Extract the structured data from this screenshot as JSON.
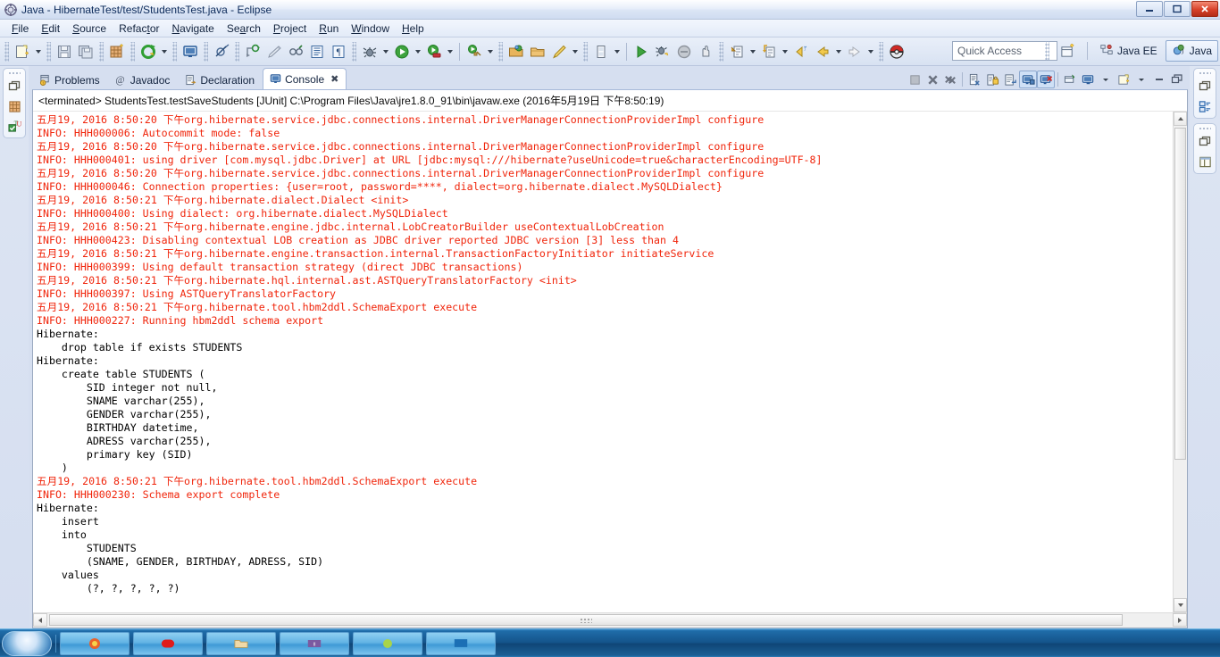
{
  "window": {
    "title": "Java - HibernateTest/test/StudentsTest.java - Eclipse",
    "icon": "eclipse-icon",
    "minimize_label": "–",
    "maximize_label": "❐",
    "close_label": "✕"
  },
  "menubar": {
    "items": [
      {
        "label": "File",
        "mnemonic": "F"
      },
      {
        "label": "Edit",
        "mnemonic": "E"
      },
      {
        "label": "Source",
        "mnemonic": "S"
      },
      {
        "label": "Refactor",
        "mnemonic": "t"
      },
      {
        "label": "Navigate",
        "mnemonic": "N"
      },
      {
        "label": "Search",
        "mnemonic": "a"
      },
      {
        "label": "Project",
        "mnemonic": "P"
      },
      {
        "label": "Run",
        "mnemonic": "R"
      },
      {
        "label": "Window",
        "mnemonic": "W"
      },
      {
        "label": "Help",
        "mnemonic": "H"
      }
    ]
  },
  "toolbar": {
    "quick_access_placeholder": "Quick Access",
    "buttons": [
      {
        "name": "new-wizard-button",
        "icon": "new-file-icon"
      },
      {
        "name": "save-button",
        "icon": "save-icon"
      },
      {
        "name": "save-all-button",
        "icon": "save-all-icon"
      },
      {
        "name": "new-java-package-button",
        "icon": "package-icon"
      },
      {
        "name": "run-last-tool-button",
        "icon": "refresh-green-icon"
      },
      {
        "name": "open-console-button",
        "icon": "console-icon"
      },
      {
        "name": "skip-breakpoints-button",
        "icon": "no-breakpoint-icon"
      },
      {
        "name": "toggle-mark-occurrences-button",
        "icon": "mark-occurrences-icon"
      },
      {
        "name": "new-java-class-button",
        "icon": "pen-icon"
      },
      {
        "name": "search-button",
        "icon": "search-glasses-icon"
      },
      {
        "name": "open-task-button",
        "icon": "task-list-icon"
      },
      {
        "name": "open-type-button",
        "icon": "type-icon"
      },
      {
        "name": "debug-button",
        "icon": "debug-bug-icon"
      },
      {
        "name": "run-button",
        "icon": "run-green-play-icon"
      },
      {
        "name": "run-server-button",
        "icon": "run-server-icon"
      },
      {
        "name": "external-tools-button",
        "icon": "external-tools-icon"
      },
      {
        "name": "open-perspective-button",
        "icon": "open-folder-green-icon"
      },
      {
        "name": "open-resource-button",
        "icon": "open-folder-icon"
      },
      {
        "name": "annotation-button",
        "icon": "pencil-yellow-icon"
      },
      {
        "name": "coverage-button",
        "icon": "coverage-icon"
      },
      {
        "name": "resume-button",
        "icon": "resume-green-icon"
      },
      {
        "name": "debug-last-button",
        "icon": "debug-last-icon"
      },
      {
        "name": "terminate-button",
        "icon": "terminate-gray-icon"
      },
      {
        "name": "suspend-button",
        "icon": "hand-icon"
      },
      {
        "name": "step-into-button",
        "icon": "step-into-icon"
      },
      {
        "name": "step-return-button",
        "icon": "step-return-icon"
      },
      {
        "name": "previous-annotation-button",
        "icon": "back-yellow-arrow-icon"
      },
      {
        "name": "back-button",
        "icon": "back-arrow-icon"
      },
      {
        "name": "forward-button",
        "icon": "forward-arrow-icon"
      },
      {
        "name": "pokeball-button",
        "icon": "pokeball-icon"
      }
    ],
    "perspectives": [
      {
        "name": "open-perspective",
        "label": "",
        "icon": "open-perspective-icon",
        "selected": false
      },
      {
        "name": "perspective-java-ee",
        "label": "Java EE",
        "icon": "java-ee-icon",
        "selected": false
      },
      {
        "name": "perspective-java",
        "label": "Java",
        "icon": "java-icon",
        "selected": true
      }
    ]
  },
  "left_rail": {
    "groups": [
      {
        "items": [
          {
            "name": "restore-icon",
            "icon": "restore-icon"
          },
          {
            "name": "package-explorer-icon",
            "icon": "package-explorer-icon"
          },
          {
            "name": "junit-icon",
            "icon": "junit-icon"
          }
        ]
      }
    ]
  },
  "right_rail": {
    "groups": [
      {
        "items": [
          {
            "name": "restore-icon",
            "icon": "restore-icon"
          },
          {
            "name": "outline-icon",
            "icon": "outline-icon"
          }
        ]
      },
      {
        "items": [
          {
            "name": "restore-icon",
            "icon": "restore-icon"
          },
          {
            "name": "task-list-icon",
            "icon": "task-list-icon"
          }
        ]
      }
    ]
  },
  "view_tabs": [
    {
      "label": "Problems",
      "icon": "problems-icon",
      "active": false,
      "closable": false
    },
    {
      "label": "Javadoc",
      "icon": "javadoc-at-icon",
      "active": false,
      "closable": false
    },
    {
      "label": "Declaration",
      "icon": "declaration-icon",
      "active": false,
      "closable": false
    },
    {
      "label": "Console",
      "icon": "console-icon",
      "active": true,
      "closable": true,
      "close_glyph": "✖"
    }
  ],
  "view_toolbar": {
    "buttons": [
      {
        "name": "terminate-button",
        "icon": "terminate-square-icon",
        "on": false
      },
      {
        "name": "remove-launch-button",
        "icon": "remove-x-icon",
        "on": false
      },
      {
        "name": "remove-all-terminated-button",
        "icon": "remove-all-x-icon",
        "on": false
      },
      {
        "name": "clear-console-button",
        "icon": "clear-console-icon",
        "on": false
      },
      {
        "name": "scroll-lock-button",
        "icon": "scroll-lock-icon",
        "on": false
      },
      {
        "name": "word-wrap-button",
        "icon": "word-wrap-icon",
        "on": false
      },
      {
        "name": "show-console-on-output-button",
        "icon": "show-console-stdout-icon",
        "on": true
      },
      {
        "name": "show-console-on-error-button",
        "icon": "show-console-stderr-icon",
        "on": true
      },
      {
        "name": "pin-console-button",
        "icon": "pin-console-icon",
        "on": false
      },
      {
        "name": "display-selected-console-button",
        "icon": "display-console-icon",
        "on": false
      },
      {
        "name": "open-console-button",
        "icon": "new-console-icon",
        "on": false
      },
      {
        "name": "minimize-button",
        "icon": "minimize-icon",
        "on": false
      },
      {
        "name": "maximize-button",
        "icon": "maximize-icon",
        "on": false
      }
    ]
  },
  "console": {
    "header": "<terminated> StudentsTest.testSaveStudents [JUnit] C:\\Program Files\\Java\\jre1.8.0_91\\bin\\javaw.exe (2016年5月19日 下午8:50:19)",
    "lines": [
      {
        "stream": "err",
        "text": "五月19, 2016 8:50:20 下午org.hibernate.service.jdbc.connections.internal.DriverManagerConnectionProviderImpl configure"
      },
      {
        "stream": "err",
        "text": "INFO: HHH000006: Autocommit mode: false"
      },
      {
        "stream": "err",
        "text": "五月19, 2016 8:50:20 下午org.hibernate.service.jdbc.connections.internal.DriverManagerConnectionProviderImpl configure"
      },
      {
        "stream": "err",
        "text": "INFO: HHH000401: using driver [com.mysql.jdbc.Driver] at URL [jdbc:mysql:///hibernate?useUnicode=true&characterEncoding=UTF-8]"
      },
      {
        "stream": "err",
        "text": "五月19, 2016 8:50:20 下午org.hibernate.service.jdbc.connections.internal.DriverManagerConnectionProviderImpl configure"
      },
      {
        "stream": "err",
        "text": "INFO: HHH000046: Connection properties: {user=root, password=****, dialect=org.hibernate.dialect.MySQLDialect}"
      },
      {
        "stream": "err",
        "text": "五月19, 2016 8:50:21 下午org.hibernate.dialect.Dialect <init>"
      },
      {
        "stream": "err",
        "text": "INFO: HHH000400: Using dialect: org.hibernate.dialect.MySQLDialect"
      },
      {
        "stream": "err",
        "text": "五月19, 2016 8:50:21 下午org.hibernate.engine.jdbc.internal.LobCreatorBuilder useContextualLobCreation"
      },
      {
        "stream": "err",
        "text": "INFO: HHH000423: Disabling contextual LOB creation as JDBC driver reported JDBC version [3] less than 4"
      },
      {
        "stream": "err",
        "text": "五月19, 2016 8:50:21 下午org.hibernate.engine.transaction.internal.TransactionFactoryInitiator initiateService"
      },
      {
        "stream": "err",
        "text": "INFO: HHH000399: Using default transaction strategy (direct JDBC transactions)"
      },
      {
        "stream": "err",
        "text": "五月19, 2016 8:50:21 下午org.hibernate.hql.internal.ast.ASTQueryTranslatorFactory <init>"
      },
      {
        "stream": "err",
        "text": "INFO: HHH000397: Using ASTQueryTranslatorFactory"
      },
      {
        "stream": "err",
        "text": "五月19, 2016 8:50:21 下午org.hibernate.tool.hbm2ddl.SchemaExport execute"
      },
      {
        "stream": "err",
        "text": "INFO: HHH000227: Running hbm2ddl schema export"
      },
      {
        "stream": "out",
        "text": "Hibernate: "
      },
      {
        "stream": "out",
        "text": "    drop table if exists STUDENTS"
      },
      {
        "stream": "out",
        "text": "Hibernate: "
      },
      {
        "stream": "out",
        "text": "    create table STUDENTS ("
      },
      {
        "stream": "out",
        "text": "        SID integer not null,"
      },
      {
        "stream": "out",
        "text": "        SNAME varchar(255),"
      },
      {
        "stream": "out",
        "text": "        GENDER varchar(255),"
      },
      {
        "stream": "out",
        "text": "        BIRTHDAY datetime,"
      },
      {
        "stream": "out",
        "text": "        ADRESS varchar(255),"
      },
      {
        "stream": "out",
        "text": "        primary key (SID)"
      },
      {
        "stream": "out",
        "text": "    )"
      },
      {
        "stream": "err",
        "text": "五月19, 2016 8:50:21 下午org.hibernate.tool.hbm2ddl.SchemaExport execute"
      },
      {
        "stream": "err",
        "text": "INFO: HHH000230: Schema export complete"
      },
      {
        "stream": "out",
        "text": "Hibernate: "
      },
      {
        "stream": "out",
        "text": "    insert "
      },
      {
        "stream": "out",
        "text": "    into"
      },
      {
        "stream": "out",
        "text": "        STUDENTS"
      },
      {
        "stream": "out",
        "text": "        (SNAME, GENDER, BIRTHDAY, ADRESS, SID) "
      },
      {
        "stream": "out",
        "text": "    values"
      },
      {
        "stream": "out",
        "text": "        (?, ?, ?, ?, ?)"
      }
    ]
  },
  "colors": {
    "stderr": "#f0250b",
    "stdout": "#000000",
    "chrome": "#d6dff0",
    "accent_selected": "#cfe0f6"
  },
  "taskbar": {
    "start_label": "",
    "items": [
      {
        "name": "taskbar-item-browser",
        "icon": "firefox-icon"
      },
      {
        "name": "taskbar-item-media",
        "icon": "media-red-icon"
      },
      {
        "name": "taskbar-item-explorer",
        "icon": "folder-icon"
      },
      {
        "name": "taskbar-item-app-purple",
        "icon": "purple-app-icon"
      },
      {
        "name": "taskbar-item-app-green",
        "icon": "green-app-icon"
      },
      {
        "name": "taskbar-item-eclipse",
        "icon": "eclipse-blue-icon"
      }
    ]
  }
}
